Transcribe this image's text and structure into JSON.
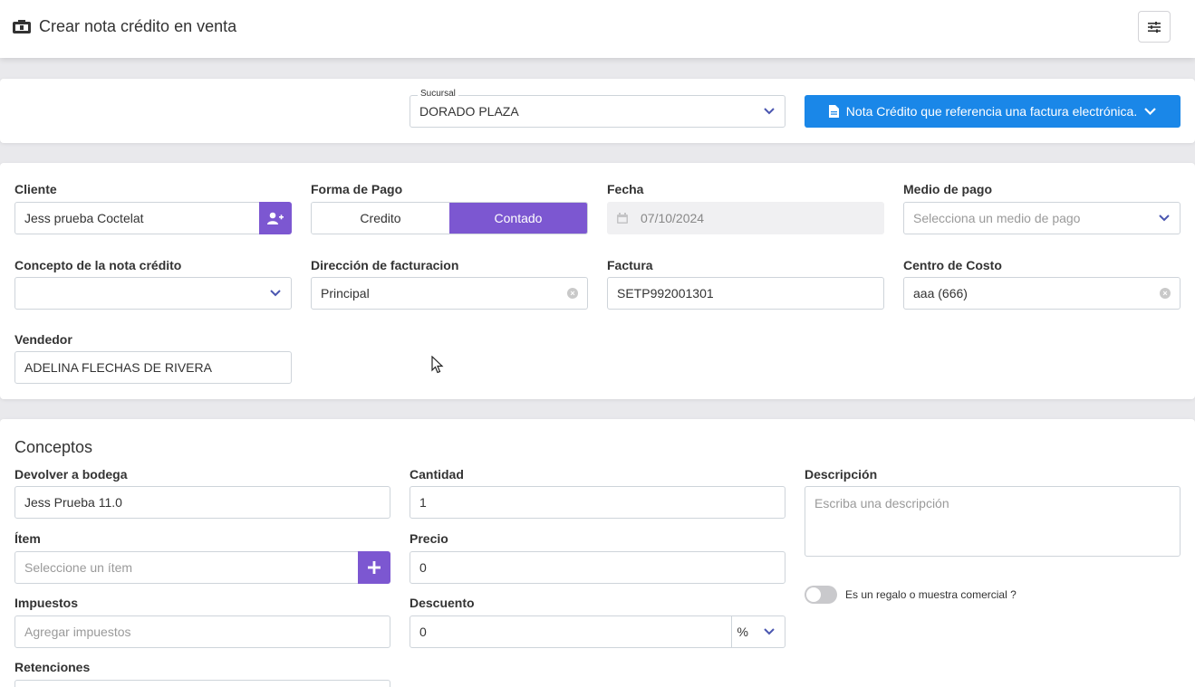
{
  "header": {
    "title": "Crear nota crédito en venta"
  },
  "branch": {
    "legend": "Sucursal",
    "value": "DORADO PLAZA",
    "doc_type_button": "Nota Crédito que referencia una factura electrónica."
  },
  "form": {
    "cliente": {
      "label": "Cliente",
      "value": "Jess prueba Coctelat"
    },
    "forma_pago": {
      "label": "Forma de Pago",
      "options": [
        "Credito",
        "Contado"
      ],
      "selected": "Contado"
    },
    "fecha": {
      "label": "Fecha",
      "value": "07/10/2024"
    },
    "medio_pago": {
      "label": "Medio de pago",
      "placeholder": "Selecciona un medio de pago"
    },
    "concepto": {
      "label": "Concepto de la nota crédito",
      "value": ""
    },
    "direccion": {
      "label": "Dirección de facturacion",
      "value": "Principal"
    },
    "factura": {
      "label": "Factura",
      "value": "SETP992001301"
    },
    "centro_costo": {
      "label": "Centro de Costo",
      "value": "aaa (666)"
    },
    "vendedor": {
      "label": "Vendedor",
      "value": "ADELINA FLECHAS DE RIVERA"
    }
  },
  "conceptos": {
    "title": "Conceptos",
    "bodega": {
      "label": "Devolver a bodega",
      "value": "Jess Prueba 11.0"
    },
    "item": {
      "label": "Ítem",
      "placeholder": "Seleccione un ítem"
    },
    "impuestos": {
      "label": "Impuestos",
      "placeholder": "Agregar impuestos"
    },
    "retenciones": {
      "label": "Retenciones"
    },
    "cantidad": {
      "label": "Cantidad",
      "value": "1"
    },
    "precio": {
      "label": "Precio",
      "value": "0"
    },
    "descuento": {
      "label": "Descuento",
      "value": "0",
      "unit": "%"
    },
    "descripcion": {
      "label": "Descripción",
      "placeholder": "Escriba una descripción"
    },
    "regalo": {
      "label": "Es un regalo o muestra comercial ?"
    }
  }
}
